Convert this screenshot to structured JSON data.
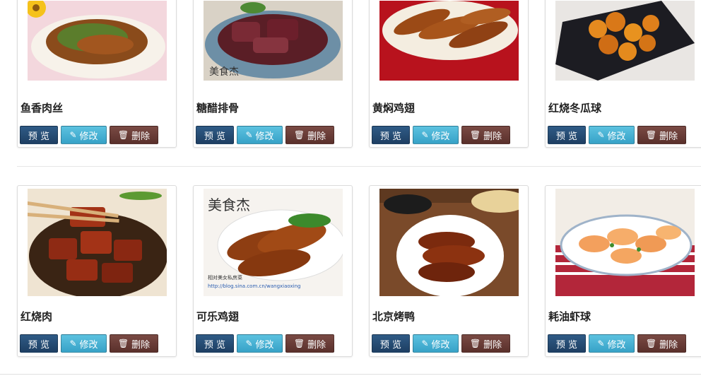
{
  "buttons": {
    "view_label": "预 览",
    "edit_label": "修改",
    "delete_label": "删除",
    "edit_icon": "edit-icon",
    "delete_icon": "trash-icon"
  },
  "rows": [
    {
      "items": [
        {
          "title": "鱼香肉丝",
          "image": "shredded-pork-dish"
        },
        {
          "title": "糖醋排骨",
          "image": "sweet-sour-ribs-dish"
        },
        {
          "title": "黄焖鸡翅",
          "image": "braised-chicken-wings-dish"
        },
        {
          "title": "红烧冬瓜球",
          "image": "braised-melon-balls-dish"
        }
      ]
    },
    {
      "items": [
        {
          "title": "红烧肉",
          "image": "braised-pork-dish"
        },
        {
          "title": "可乐鸡翅",
          "image": "cola-chicken-wings-dish"
        },
        {
          "title": "北京烤鸭",
          "image": "peking-duck-dish"
        },
        {
          "title": "耗油虾球",
          "image": "oyster-sauce-shrimp-dish"
        }
      ]
    }
  ],
  "colors": {
    "view_button": "#1e3f63",
    "edit_button": "#37a2c7",
    "delete_button": "#5a302b"
  }
}
